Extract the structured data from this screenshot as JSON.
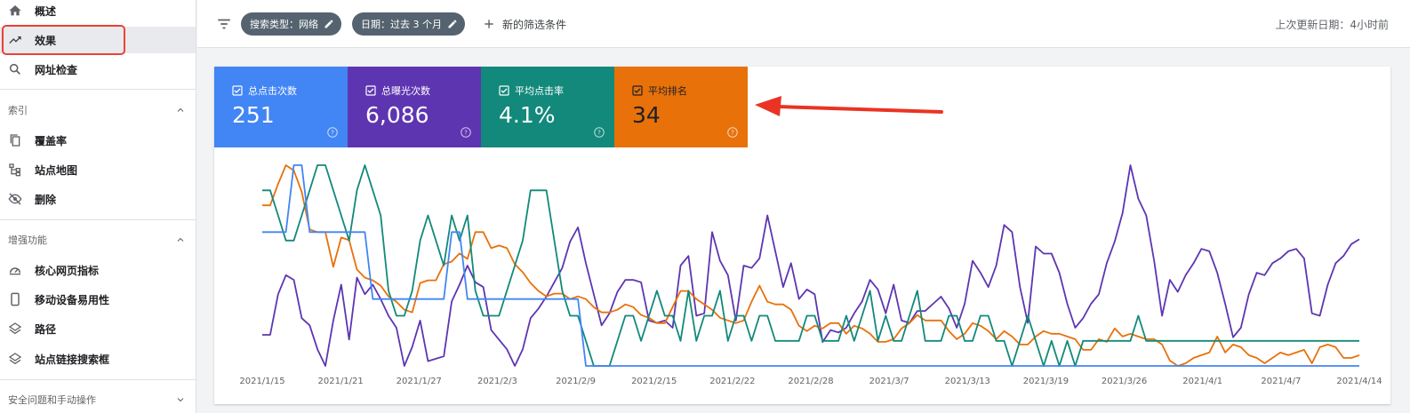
{
  "sidebar": {
    "items": [
      {
        "label": "概述",
        "icon": "home-icon"
      },
      {
        "label": "效果",
        "icon": "trending-up-icon"
      },
      {
        "label": "网址检查",
        "icon": "search-icon"
      }
    ],
    "sections": [
      {
        "title": "索引",
        "items": [
          {
            "label": "覆盖率",
            "icon": "copy-icon"
          },
          {
            "label": "站点地图",
            "icon": "sitemap-icon"
          },
          {
            "label": "删除",
            "icon": "eye-off-icon"
          }
        ]
      },
      {
        "title": "增强功能",
        "items": [
          {
            "label": "核心网页指标",
            "icon": "speed-icon"
          },
          {
            "label": "移动设备易用性",
            "icon": "phone-icon"
          },
          {
            "label": "路径",
            "icon": "layers-icon"
          },
          {
            "label": "站点链接搜索框",
            "icon": "layers-icon"
          }
        ]
      },
      {
        "title": "安全问题和手动操作"
      }
    ]
  },
  "topbar": {
    "chips": [
      "搜索类型：网络",
      "日期：过去 3 个月"
    ],
    "add_filter": "新的筛选条件",
    "last_updated": "上次更新日期：4小时前"
  },
  "metrics": [
    {
      "label": "总点击次数",
      "value": "251",
      "color": "#4285f4"
    },
    {
      "label": "总曝光次数",
      "value": "6,086",
      "color": "#5e35b1"
    },
    {
      "label": "平均点击率",
      "value": "4.1%",
      "color": "#12897b"
    },
    {
      "label": "平均排名",
      "value": "34",
      "color": "#e8710a"
    }
  ],
  "chart_data": {
    "type": "line",
    "x": [
      "2021/1/15",
      "2021/1/21",
      "2021/1/27",
      "2021/2/3",
      "2021/2/9",
      "2021/2/15",
      "2021/2/22",
      "2021/2/28",
      "2021/3/7",
      "2021/3/13",
      "2021/3/19",
      "2021/3/26",
      "2021/4/1",
      "2021/4/7",
      "2021/4/14"
    ],
    "series": [
      {
        "name": "总曝光次数",
        "color": "#5e35b1",
        "values": [
          57,
          57,
          74,
          82,
          80,
          64,
          61,
          51,
          44,
          63,
          78,
          55,
          81,
          74,
          78,
          72,
          65,
          60,
          44,
          52,
          63,
          46,
          47,
          48,
          71,
          78,
          86,
          79,
          77,
          59,
          55,
          51,
          44,
          51,
          64,
          68,
          73,
          79,
          85,
          96,
          102,
          87,
          74,
          61,
          66,
          75,
          80,
          80,
          79,
          63,
          62,
          63,
          60,
          86,
          90,
          65,
          66,
          100,
          88,
          82,
          63,
          86,
          85,
          89,
          107,
          92,
          77,
          87,
          72,
          76,
          74,
          54,
          59,
          58,
          60,
          66,
          71,
          80,
          76,
          66,
          78,
          63,
          62,
          67,
          67,
          70,
          73,
          68,
          60,
          70,
          88,
          83,
          77,
          86,
          103,
          100,
          77,
          62,
          94,
          91,
          91,
          83,
          70,
          60,
          64,
          70,
          74,
          87,
          96,
          108,
          128,
          114,
          107,
          88,
          65,
          80,
          75,
          82,
          87,
          93,
          92,
          83,
          70,
          56,
          60,
          74,
          83,
          82,
          87,
          89,
          92,
          93,
          89,
          66,
          65,
          78,
          87,
          90,
          95,
          97
        ]
      },
      {
        "name": "平均排名",
        "color": "#e8710a",
        "values": [
          68,
          68,
          76,
          83,
          81,
          73,
          59,
          58,
          58,
          45,
          56,
          55,
          44,
          41,
          40,
          38,
          34,
          32,
          29,
          28,
          39,
          40,
          40,
          46,
          47,
          50,
          48,
          58,
          58,
          52,
          53,
          52,
          46,
          43,
          39,
          36,
          34,
          35,
          35,
          33,
          34,
          33,
          30,
          28,
          28,
          29,
          31,
          30,
          27,
          26,
          24,
          24,
          30,
          36,
          36,
          33,
          31,
          29,
          26,
          25,
          24,
          25,
          32,
          38,
          32,
          31,
          31,
          29,
          23,
          21,
          23,
          22,
          24,
          24,
          20,
          23,
          22,
          20,
          17,
          17,
          18,
          22,
          24,
          27,
          25,
          25,
          25,
          21,
          18,
          20,
          24,
          23,
          21,
          18,
          21,
          19,
          16,
          16,
          19,
          21,
          20,
          20,
          19,
          18,
          14,
          14,
          18,
          17,
          22,
          19,
          20,
          19,
          18,
          18,
          16,
          10,
          8,
          9,
          11,
          12,
          13,
          19,
          13,
          16,
          15,
          12,
          11,
          9,
          11,
          13,
          12,
          13,
          14,
          9,
          15,
          16,
          15,
          11,
          11,
          12
        ]
      },
      {
        "name": "平均点击率",
        "color": "#12897b",
        "values": [
          8,
          8,
          7,
          6,
          6,
          7,
          8,
          9,
          9,
          8,
          7,
          6,
          8,
          9,
          8,
          7,
          4,
          3,
          3,
          4,
          6,
          7,
          6,
          5,
          7,
          6,
          7,
          4,
          3,
          3,
          3,
          4,
          5,
          6,
          8,
          8,
          8,
          6,
          4,
          3,
          3,
          2,
          1,
          1,
          1,
          2,
          3,
          3,
          2,
          3,
          4,
          3,
          3,
          2,
          4,
          2,
          3,
          3,
          4,
          2,
          3,
          3,
          2,
          3,
          3,
          2,
          2,
          2,
          2,
          3,
          3,
          2,
          2,
          2,
          3,
          2,
          3,
          4,
          2,
          3,
          2,
          2,
          3,
          4,
          2,
          2,
          2,
          3,
          3,
          2,
          2,
          3,
          3,
          2,
          2,
          1,
          2,
          3,
          2,
          1,
          2,
          1,
          2,
          1,
          2,
          2,
          2,
          2,
          2,
          2,
          2,
          3,
          2,
          2,
          2,
          2,
          2,
          2,
          2,
          2,
          2,
          2,
          2,
          2,
          2,
          2,
          2,
          2,
          2,
          2,
          2,
          2,
          2,
          2,
          2,
          2,
          2,
          2,
          2,
          2
        ]
      },
      {
        "name": "总点击次数",
        "color": "#4285f4",
        "values": [
          3,
          3,
          3,
          3,
          4,
          4,
          3,
          3,
          3,
          3,
          3,
          3,
          3,
          3,
          2,
          2,
          2,
          2,
          2,
          2,
          2,
          2,
          2,
          2,
          3,
          3,
          2,
          2,
          2,
          2,
          2,
          2,
          2,
          2,
          2,
          2,
          2,
          2,
          2,
          2,
          2,
          1,
          1,
          1,
          1,
          1,
          1,
          1,
          1,
          1,
          1,
          1,
          1,
          1,
          1,
          1,
          1,
          1,
          1,
          1,
          1,
          1,
          1,
          1,
          1,
          1,
          1,
          1,
          1,
          1,
          1,
          1,
          1,
          1,
          1,
          1,
          1,
          1,
          1,
          1,
          1,
          1,
          1,
          1,
          1,
          1,
          1,
          1,
          1,
          1,
          1,
          1,
          1,
          1,
          1,
          1,
          1,
          1,
          1,
          1,
          1,
          1,
          1,
          1,
          1,
          1,
          1,
          1,
          1,
          1,
          1,
          1,
          1,
          1,
          1,
          1,
          1,
          1,
          1,
          1,
          1,
          1,
          1,
          1,
          1,
          1,
          1,
          1,
          1,
          1,
          1,
          1,
          1,
          1,
          1,
          1,
          1,
          1,
          1,
          1
        ]
      }
    ],
    "ylim_per_series": true,
    "grid": false,
    "legend": "none"
  }
}
